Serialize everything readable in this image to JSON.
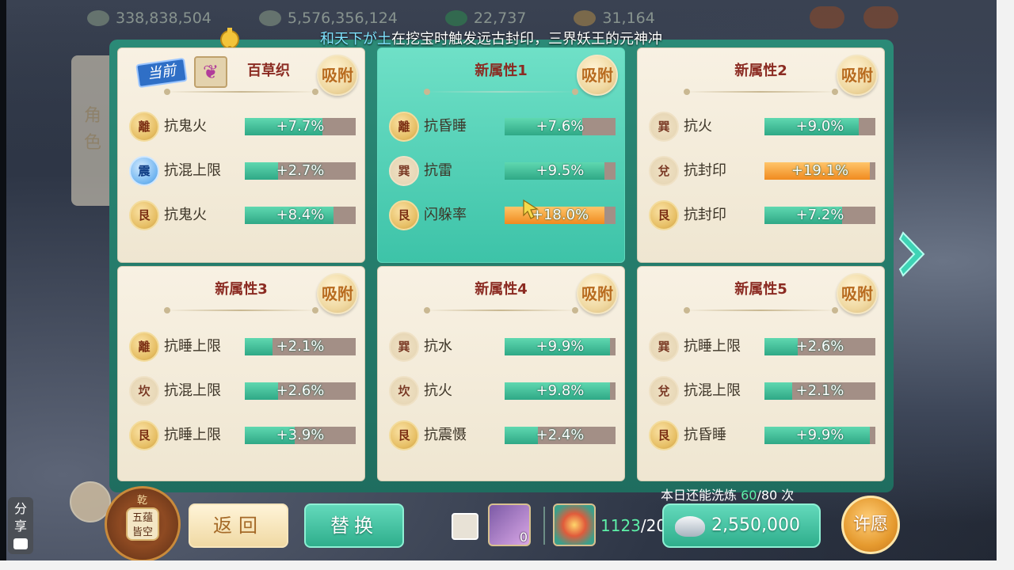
{
  "topbar": {
    "currencies": [
      "338,838,504",
      "5,576,356,124",
      "22,737",
      "31,164"
    ]
  },
  "ticker": {
    "name": "和天下が土",
    "message": "在挖宝时触发远古封印，三界妖王的元神冲"
  },
  "side": {
    "label": "角色"
  },
  "absorb_label": "吸附",
  "current_badge": "当前",
  "cards": [
    {
      "title": "百草织",
      "wing_icon": "butterfly-wing",
      "rows": [
        {
          "trigram": "離",
          "label": "抗鬼火",
          "value": "+7.7%",
          "fill": 0.7
        },
        {
          "trigram": "震",
          "label": "抗混上限",
          "value": "+2.7%",
          "fill": 0.3
        },
        {
          "trigram": "艮",
          "label": "抗鬼火",
          "value": "+8.4%",
          "fill": 0.8
        }
      ]
    },
    {
      "title": "新属性1",
      "rows": [
        {
          "trigram": "離",
          "label": "抗昏睡",
          "value": "+7.6%",
          "fill": 0.7
        },
        {
          "trigram": "巽",
          "label": "抗雷",
          "value": "+9.5%",
          "fill": 0.9
        },
        {
          "trigram": "艮",
          "label": "闪躲率",
          "value": "+18.0%",
          "fill": 0.9,
          "color": "orange"
        }
      ]
    },
    {
      "title": "新属性2",
      "rows": [
        {
          "trigram": "巽",
          "label": "抗火",
          "value": "+9.0%",
          "fill": 0.85
        },
        {
          "trigram": "兌",
          "label": "抗封印",
          "value": "+19.1%",
          "fill": 0.95,
          "color": "orange"
        },
        {
          "trigram": "艮",
          "label": "抗封印",
          "value": "+7.2%",
          "fill": 0.7
        }
      ]
    },
    {
      "title": "新属性3",
      "rows": [
        {
          "trigram": "離",
          "label": "抗睡上限",
          "value": "+2.1%",
          "fill": 0.25
        },
        {
          "trigram": "坎",
          "label": "抗混上限",
          "value": "+2.6%",
          "fill": 0.3
        },
        {
          "trigram": "艮",
          "label": "抗睡上限",
          "value": "+3.9%",
          "fill": 0.45
        }
      ]
    },
    {
      "title": "新属性4",
      "rows": [
        {
          "trigram": "巽",
          "label": "抗水",
          "value": "+9.9%",
          "fill": 0.95
        },
        {
          "trigram": "坎",
          "label": "抗火",
          "value": "+9.8%",
          "fill": 0.95
        },
        {
          "trigram": "艮",
          "label": "抗震慑",
          "value": "+2.4%",
          "fill": 0.3
        }
      ]
    },
    {
      "title": "新属性5",
      "rows": [
        {
          "trigram": "巽",
          "label": "抗睡上限",
          "value": "+2.6%",
          "fill": 0.3
        },
        {
          "trigram": "兌",
          "label": "抗混上限",
          "value": "+2.1%",
          "fill": 0.25
        },
        {
          "trigram": "艮",
          "label": "抗昏睡",
          "value": "+9.9%",
          "fill": 0.95
        }
      ]
    }
  ],
  "bottom": {
    "wash_prefix": "本日还能洗炼",
    "wash_remaining": "60",
    "wash_total": "/80 次",
    "back_label": "返回",
    "replace_label": "替换",
    "item1_count": "0",
    "count_have": "1123",
    "count_need": "/20",
    "silver_amount": "2,550,000",
    "wish_label": "许愿",
    "share_label": "分享",
    "wheel_top": "乾",
    "wheel_center": "五蕴皆空"
  },
  "colors": {
    "accent_green": "#2fae8c",
    "selected_card": "#3dc3a8",
    "title_red": "#8b2b22",
    "orange_bar": "#f08a1f"
  }
}
